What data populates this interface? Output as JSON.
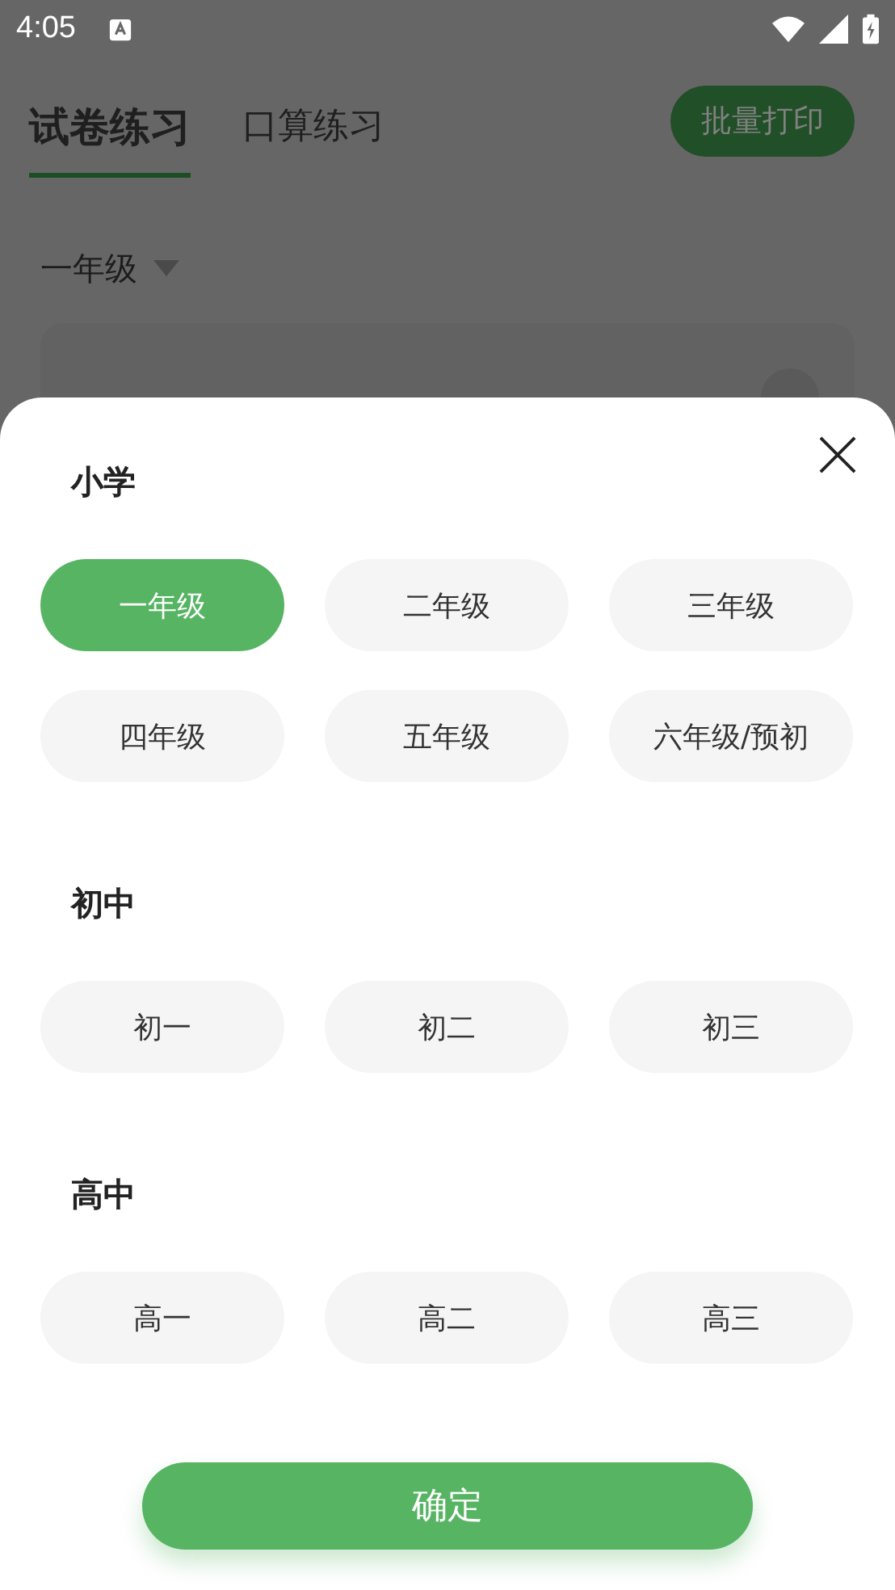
{
  "status_bar": {
    "time": "4:05"
  },
  "tabs": [
    {
      "label": "试卷练习",
      "selected": true
    },
    {
      "label": "口算练习",
      "selected": false
    }
  ],
  "print_button": "批量打印",
  "grade_selector": {
    "label": "一年级"
  },
  "sheet": {
    "sections": [
      {
        "title": "小学",
        "options": [
          {
            "label": "一年级",
            "selected": true
          },
          {
            "label": "二年级",
            "selected": false
          },
          {
            "label": "三年级",
            "selected": false
          },
          {
            "label": "四年级",
            "selected": false
          },
          {
            "label": "五年级",
            "selected": false
          },
          {
            "label": "六年级/预初",
            "selected": false
          }
        ]
      },
      {
        "title": "初中",
        "options": [
          {
            "label": "初一",
            "selected": false
          },
          {
            "label": "初二",
            "selected": false
          },
          {
            "label": "初三",
            "selected": false
          }
        ]
      },
      {
        "title": "高中",
        "options": [
          {
            "label": "高一",
            "selected": false
          },
          {
            "label": "高二",
            "selected": false
          },
          {
            "label": "高三",
            "selected": false
          }
        ]
      }
    ],
    "confirm": "确定"
  }
}
